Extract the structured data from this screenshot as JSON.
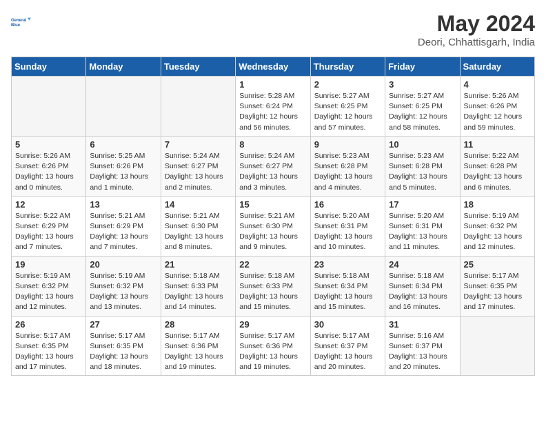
{
  "header": {
    "logo_line1": "General",
    "logo_line2": "Blue",
    "month_year": "May 2024",
    "location": "Deori, Chhattisgarh, India"
  },
  "weekdays": [
    "Sunday",
    "Monday",
    "Tuesday",
    "Wednesday",
    "Thursday",
    "Friday",
    "Saturday"
  ],
  "weeks": [
    [
      {
        "day": "",
        "info": ""
      },
      {
        "day": "",
        "info": ""
      },
      {
        "day": "",
        "info": ""
      },
      {
        "day": "1",
        "info": "Sunrise: 5:28 AM\nSunset: 6:24 PM\nDaylight: 12 hours\nand 56 minutes."
      },
      {
        "day": "2",
        "info": "Sunrise: 5:27 AM\nSunset: 6:25 PM\nDaylight: 12 hours\nand 57 minutes."
      },
      {
        "day": "3",
        "info": "Sunrise: 5:27 AM\nSunset: 6:25 PM\nDaylight: 12 hours\nand 58 minutes."
      },
      {
        "day": "4",
        "info": "Sunrise: 5:26 AM\nSunset: 6:26 PM\nDaylight: 12 hours\nand 59 minutes."
      }
    ],
    [
      {
        "day": "5",
        "info": "Sunrise: 5:26 AM\nSunset: 6:26 PM\nDaylight: 13 hours\nand 0 minutes."
      },
      {
        "day": "6",
        "info": "Sunrise: 5:25 AM\nSunset: 6:26 PM\nDaylight: 13 hours\nand 1 minute."
      },
      {
        "day": "7",
        "info": "Sunrise: 5:24 AM\nSunset: 6:27 PM\nDaylight: 13 hours\nand 2 minutes."
      },
      {
        "day": "8",
        "info": "Sunrise: 5:24 AM\nSunset: 6:27 PM\nDaylight: 13 hours\nand 3 minutes."
      },
      {
        "day": "9",
        "info": "Sunrise: 5:23 AM\nSunset: 6:28 PM\nDaylight: 13 hours\nand 4 minutes."
      },
      {
        "day": "10",
        "info": "Sunrise: 5:23 AM\nSunset: 6:28 PM\nDaylight: 13 hours\nand 5 minutes."
      },
      {
        "day": "11",
        "info": "Sunrise: 5:22 AM\nSunset: 6:28 PM\nDaylight: 13 hours\nand 6 minutes."
      }
    ],
    [
      {
        "day": "12",
        "info": "Sunrise: 5:22 AM\nSunset: 6:29 PM\nDaylight: 13 hours\nand 7 minutes."
      },
      {
        "day": "13",
        "info": "Sunrise: 5:21 AM\nSunset: 6:29 PM\nDaylight: 13 hours\nand 7 minutes."
      },
      {
        "day": "14",
        "info": "Sunrise: 5:21 AM\nSunset: 6:30 PM\nDaylight: 13 hours\nand 8 minutes."
      },
      {
        "day": "15",
        "info": "Sunrise: 5:21 AM\nSunset: 6:30 PM\nDaylight: 13 hours\nand 9 minutes."
      },
      {
        "day": "16",
        "info": "Sunrise: 5:20 AM\nSunset: 6:31 PM\nDaylight: 13 hours\nand 10 minutes."
      },
      {
        "day": "17",
        "info": "Sunrise: 5:20 AM\nSunset: 6:31 PM\nDaylight: 13 hours\nand 11 minutes."
      },
      {
        "day": "18",
        "info": "Sunrise: 5:19 AM\nSunset: 6:32 PM\nDaylight: 13 hours\nand 12 minutes."
      }
    ],
    [
      {
        "day": "19",
        "info": "Sunrise: 5:19 AM\nSunset: 6:32 PM\nDaylight: 13 hours\nand 12 minutes."
      },
      {
        "day": "20",
        "info": "Sunrise: 5:19 AM\nSunset: 6:32 PM\nDaylight: 13 hours\nand 13 minutes."
      },
      {
        "day": "21",
        "info": "Sunrise: 5:18 AM\nSunset: 6:33 PM\nDaylight: 13 hours\nand 14 minutes."
      },
      {
        "day": "22",
        "info": "Sunrise: 5:18 AM\nSunset: 6:33 PM\nDaylight: 13 hours\nand 15 minutes."
      },
      {
        "day": "23",
        "info": "Sunrise: 5:18 AM\nSunset: 6:34 PM\nDaylight: 13 hours\nand 15 minutes."
      },
      {
        "day": "24",
        "info": "Sunrise: 5:18 AM\nSunset: 6:34 PM\nDaylight: 13 hours\nand 16 minutes."
      },
      {
        "day": "25",
        "info": "Sunrise: 5:17 AM\nSunset: 6:35 PM\nDaylight: 13 hours\nand 17 minutes."
      }
    ],
    [
      {
        "day": "26",
        "info": "Sunrise: 5:17 AM\nSunset: 6:35 PM\nDaylight: 13 hours\nand 17 minutes."
      },
      {
        "day": "27",
        "info": "Sunrise: 5:17 AM\nSunset: 6:35 PM\nDaylight: 13 hours\nand 18 minutes."
      },
      {
        "day": "28",
        "info": "Sunrise: 5:17 AM\nSunset: 6:36 PM\nDaylight: 13 hours\nand 19 minutes."
      },
      {
        "day": "29",
        "info": "Sunrise: 5:17 AM\nSunset: 6:36 PM\nDaylight: 13 hours\nand 19 minutes."
      },
      {
        "day": "30",
        "info": "Sunrise: 5:17 AM\nSunset: 6:37 PM\nDaylight: 13 hours\nand 20 minutes."
      },
      {
        "day": "31",
        "info": "Sunrise: 5:16 AM\nSunset: 6:37 PM\nDaylight: 13 hours\nand 20 minutes."
      },
      {
        "day": "",
        "info": ""
      }
    ]
  ]
}
